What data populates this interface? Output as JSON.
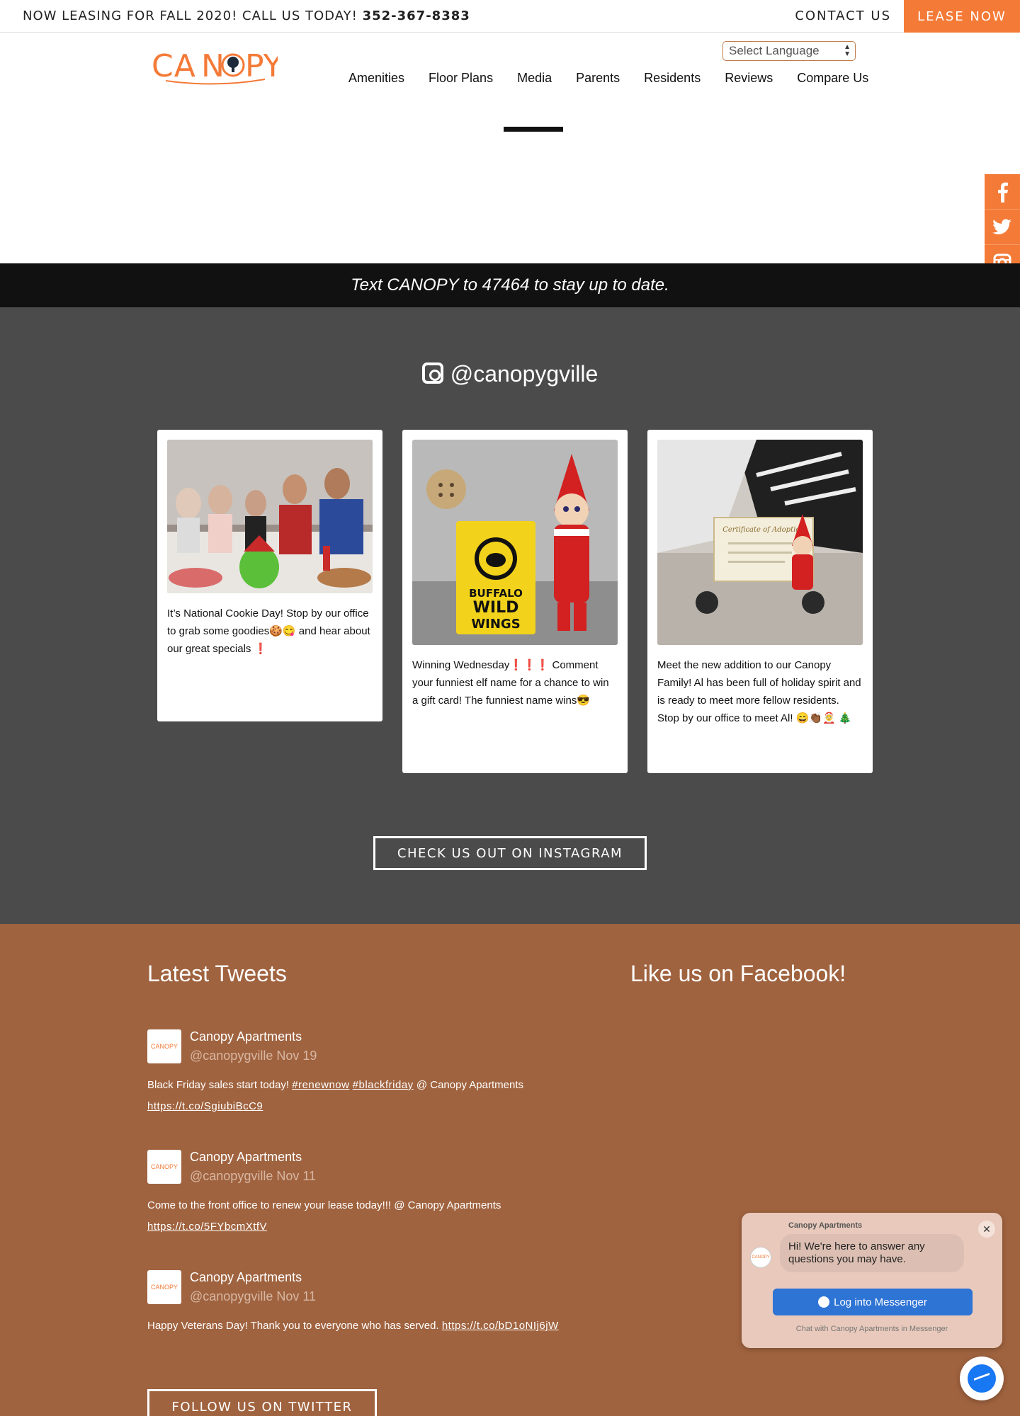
{
  "topbar": {
    "announcement": "NOW LEASING FOR FALL 2020! CALL US TODAY!",
    "phone": "352-367-8383",
    "contact_label": "CONTACT US",
    "lease_label": "LEASE NOW"
  },
  "header": {
    "logo_text": "CANOPY",
    "language_select": "Select Language",
    "nav": [
      "Amenities",
      "Floor Plans",
      "Media",
      "Parents",
      "Residents",
      "Reviews",
      "Compare Us"
    ]
  },
  "social": {
    "facebook": "f",
    "twitter": "t",
    "instagram": "ig"
  },
  "banner": {
    "text": "Text CANOPY to 47464 to stay up to date."
  },
  "instagram": {
    "handle": "@canopygville",
    "posts": [
      {
        "caption": "It’s National Cookie Day! Stop by our office to grab some goodies🍪😋 and hear about our great specials ❗"
      },
      {
        "caption": "Winning Wednesday❗❗❗ Comment your funniest elf name for a chance to win a gift card! The funniest name wins😎"
      },
      {
        "caption": "Meet the new addition to our Canopy Family! Al has been full of holiday spirit and is ready to meet more fellow residents. Stop by our office to meet Al! 😄👏🏾🤶 🎄"
      }
    ],
    "button_label": "CHECK US OUT ON INSTAGRAM"
  },
  "footer": {
    "tweets_title": "Latest Tweets",
    "facebook_title": "Like us on Facebook!",
    "tweets": [
      {
        "name": "Canopy Apartments",
        "handle": "@canopygville Nov 19",
        "text": "Black Friday sales start today!",
        "tag1": "#renewnow",
        "tag2": "#blackfriday",
        "suffix": "@ Canopy Apartments",
        "link": "https://t.co/SgiubiBcC9"
      },
      {
        "name": "Canopy Apartments",
        "handle": "@canopygville Nov 11",
        "text": "Come to the front office to renew your lease today!!! @ Canopy Apartments",
        "link": "https://t.co/5FYbcmXtfV"
      },
      {
        "name": "Canopy Apartments",
        "handle": "@canopygville Nov 11",
        "text": "Happy Veterans Day! Thank you to everyone who has served.",
        "link": "https://t.co/bD1oNIj6jW"
      }
    ],
    "twitter_button": "FOLLOW US ON TWITTER"
  },
  "messenger": {
    "title": "Canopy Apartments",
    "greeting": "Hi! We're here to answer any questions you may have.",
    "login_label": "Log into Messenger",
    "footer_text": "Chat with Canopy Apartments in Messenger"
  },
  "colors": {
    "accent": "#f47a37",
    "banner": "#111111",
    "instagram_bg": "#4b4b4b",
    "footer_bg": "#a0633f"
  }
}
